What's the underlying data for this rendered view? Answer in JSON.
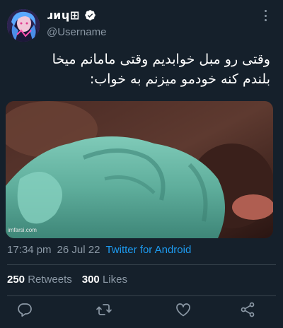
{
  "author": {
    "display_name": "ɹᴎɥ⊞",
    "username": "@Username",
    "verified": true
  },
  "tweet": {
    "text_line1": "وقتی رو مبل خوابدیم وقتی مامانم میخا",
    "text_line2": "بلندم کنه خودمو میزنم به خواب:",
    "media_watermark": "imfarsi.com",
    "time": "17:34 pm",
    "date": "26 Jul 22",
    "source": "Twitter for Android"
  },
  "stats": {
    "retweets_count": "250",
    "retweets_label": "Retweets",
    "likes_count": "300",
    "likes_label": "Likes"
  },
  "colors": {
    "background": "#15202b",
    "text_primary": "#ffffff",
    "text_secondary": "#8b98a5",
    "accent": "#1d9bf0",
    "divider": "#38444d"
  },
  "icons": {
    "verified": "verified-badge-icon",
    "more": "more-options-icon",
    "reply": "reply-icon",
    "retweet": "retweet-icon",
    "like": "heart-icon",
    "share": "share-icon"
  }
}
